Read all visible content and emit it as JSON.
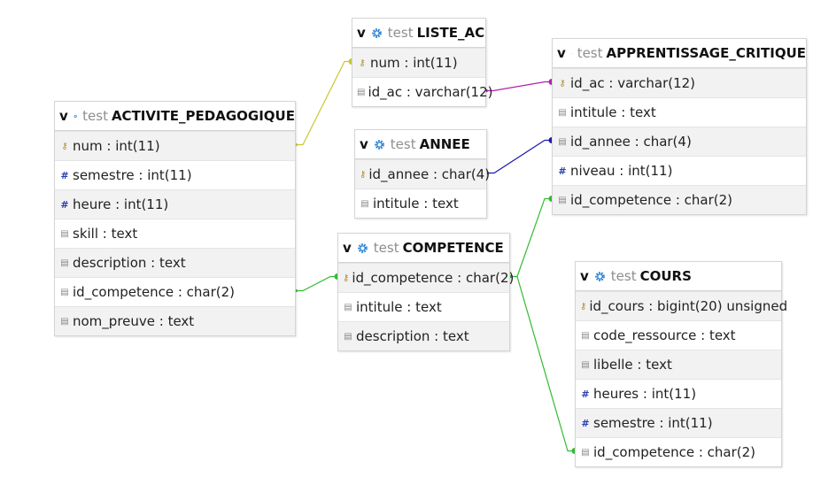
{
  "tables": [
    {
      "id": "activite",
      "db": "test",
      "name": "ACTIVITE_PEDAGOGIQUE",
      "toggle": "v",
      "fields": [
        {
          "label": "num : int(11)",
          "kind": "key"
        },
        {
          "label": "semestre : int(11)",
          "kind": "num"
        },
        {
          "label": "heure : int(11)",
          "kind": "num"
        },
        {
          "label": "skill : text",
          "kind": "txt"
        },
        {
          "label": "description : text",
          "kind": "txt"
        },
        {
          "label": "id_competence : char(2)",
          "kind": "txt"
        },
        {
          "label": "nom_preuve : text",
          "kind": "txt"
        }
      ]
    },
    {
      "id": "liste_ac",
      "db": "test",
      "name": "LISTE_AC",
      "toggle": "v",
      "fields": [
        {
          "label": "num : int(11)",
          "kind": "key"
        },
        {
          "label": "id_ac : varchar(12)",
          "kind": "txt"
        }
      ]
    },
    {
      "id": "annee",
      "db": "test",
      "name": "ANNEE",
      "toggle": "v",
      "fields": [
        {
          "label": "id_annee : char(4)",
          "kind": "key"
        },
        {
          "label": "intitule : text",
          "kind": "txt"
        }
      ]
    },
    {
      "id": "apprentissage",
      "db": "test",
      "name": "APPRENTISSAGE_CRITIQUE",
      "toggle": "v",
      "fields": [
        {
          "label": "id_ac : varchar(12)",
          "kind": "key"
        },
        {
          "label": "intitule : text",
          "kind": "txt"
        },
        {
          "label": "id_annee : char(4)",
          "kind": "txt"
        },
        {
          "label": "niveau : int(11)",
          "kind": "num"
        },
        {
          "label": "id_competence : char(2)",
          "kind": "txt"
        }
      ]
    },
    {
      "id": "competence",
      "db": "test",
      "name": "COMPETENCE",
      "toggle": "v",
      "fields": [
        {
          "label": "id_competence : char(2)",
          "kind": "key"
        },
        {
          "label": "intitule : text",
          "kind": "txt"
        },
        {
          "label": "description : text",
          "kind": "txt"
        }
      ]
    },
    {
      "id": "cours",
      "db": "test",
      "name": "COURS",
      "toggle": "v",
      "fields": [
        {
          "label": "id_cours : bigint(20) unsigned",
          "kind": "key"
        },
        {
          "label": "code_ressource : text",
          "kind": "txt"
        },
        {
          "label": "libelle : text",
          "kind": "txt"
        },
        {
          "label": "heures : int(11)",
          "kind": "num"
        },
        {
          "label": "semestre : int(11)",
          "kind": "num"
        },
        {
          "label": "id_competence : char(2)",
          "kind": "txt"
        }
      ]
    }
  ],
  "relations": [
    {
      "from": "activite",
      "from_field": 0,
      "to": "liste_ac",
      "to_field": 0,
      "color": "#c8c832"
    },
    {
      "from": "liste_ac",
      "from_field": 1,
      "to": "apprentissage",
      "to_field": 0,
      "color": "#b020b0"
    },
    {
      "from": "annee",
      "from_field": 0,
      "to": "apprentissage",
      "to_field": 2,
      "color": "#1a1ab0"
    },
    {
      "from": "activite",
      "from_field": 5,
      "to": "competence",
      "to_field": 0,
      "color": "#33bb33"
    },
    {
      "from": "competence",
      "from_field": 0,
      "to": "apprentissage",
      "to_field": 4,
      "color": "#33bb33"
    },
    {
      "from": "competence",
      "from_field": 0,
      "to": "cours",
      "to_field": 5,
      "color": "#33bb33"
    }
  ],
  "icons": {
    "key": "key-icon",
    "num": "number-icon",
    "txt": "text-icon",
    "gear": "gear-icon"
  }
}
